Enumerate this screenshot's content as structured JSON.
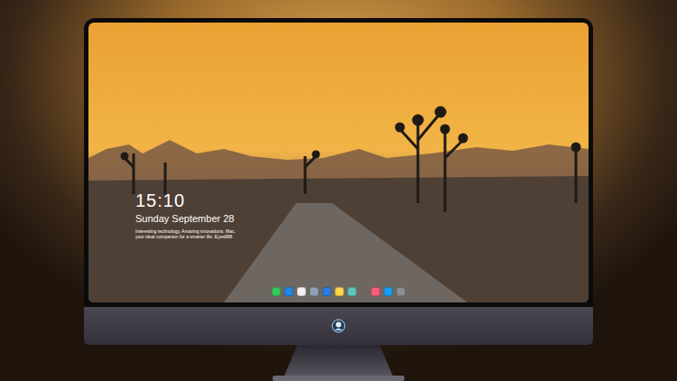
{
  "lock_screen": {
    "time": "15:10",
    "date": "Sunday September 28",
    "tagline": "Interesting technology, Amazing innovations, Mac, your ideal companion for a smarter life. Eyes888"
  },
  "dock": {
    "items": [
      {
        "color": "#34c759"
      },
      {
        "color": "#1e88e5"
      },
      {
        "color": "#f2f2f2"
      },
      {
        "color": "#8fa3b8"
      },
      {
        "color": "#2d7be0"
      },
      {
        "color": "#ffd84a"
      },
      {
        "color": "#5cc7c0"
      },
      {
        "color": "#fb5c7c"
      },
      {
        "color": "#1a9bf0"
      },
      {
        "color": "#8e8e93"
      }
    ]
  }
}
